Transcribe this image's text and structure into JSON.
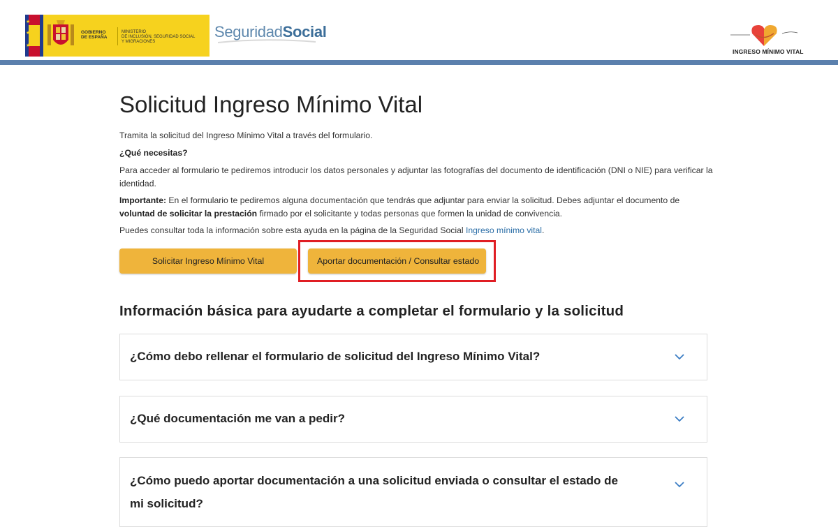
{
  "header": {
    "gov_line1": "GOBIERNO\nDE ESPAÑA",
    "gov_line2": "MINISTERIO\nDE INCLUSIÓN, SEGURIDAD SOCIAL\nY MIGRACIONES",
    "ss_part1": "Seguridad",
    "ss_part2": "Social",
    "imv_label": "INGRESO MÍNIMO VITAL"
  },
  "main": {
    "title": "Solicitud Ingreso Mínimo Vital",
    "intro": "Tramita la solicitud del Ingreso Mínimo Vital a través del formulario.",
    "needs_heading": "¿Qué necesitas?",
    "needs_text": "Para acceder al formulario te pediremos introducir los datos personales y adjuntar las fotografías del documento de identificación (DNI o NIE) para verificar la identidad.",
    "important_label": "Importante:",
    "important_text1": " En el formulario te pediremos alguna documentación que tendrás que adjuntar para enviar la solicitud. Debes adjuntar el documento de ",
    "important_bold": "voluntad de solicitar la prestación",
    "important_text2": " firmado por el solicitante y todas personas que formen la unidad de convivencia.",
    "info_text": "Puedes consultar toda la información sobre esta ayuda en la página de la Seguridad Social ",
    "info_link": "Ingreso mínimo vital",
    "info_end": ".",
    "btn_solicitar": "Solicitar Ingreso Mínimo Vital",
    "btn_aportar": "Aportar documentación / Consultar estado",
    "section_title": "Información básica para ayudarte a completar el formulario y la solicitud",
    "faq": [
      {
        "question": "¿Cómo debo rellenar el formulario de solicitud del Ingreso Mínimo Vital?"
      },
      {
        "question": "¿Qué documentación me van a pedir?"
      },
      {
        "question": "¿Cómo puedo aportar documentación a una solicitud enviada o consultar el estado de mi solicitud?"
      }
    ]
  },
  "colors": {
    "button": "#efb43b",
    "highlight": "#e01e24",
    "header_bar": "#5b80ad",
    "link": "#2b6ea7"
  }
}
